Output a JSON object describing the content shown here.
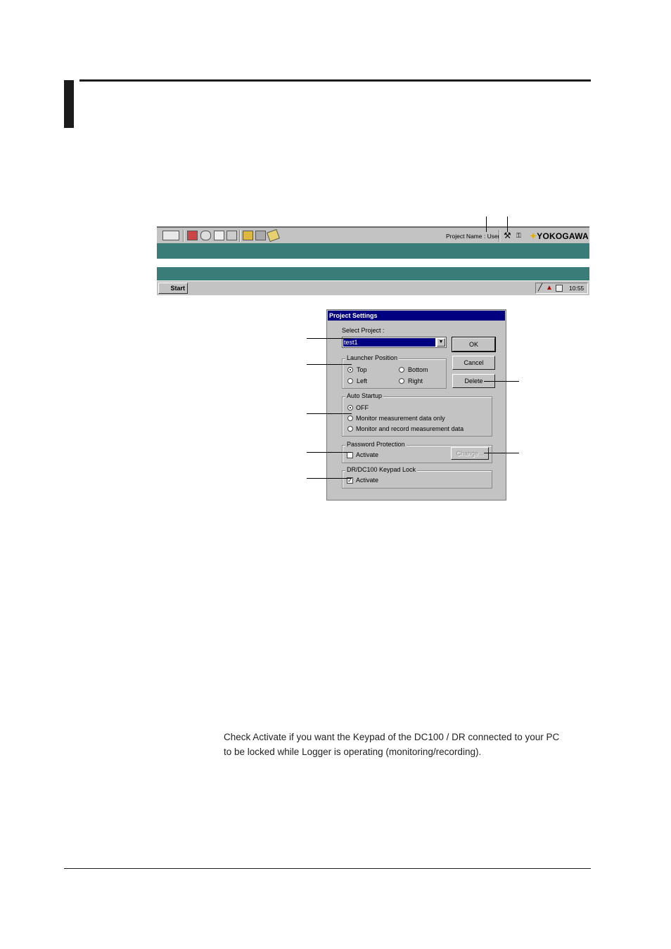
{
  "launcher": {
    "project_label": "Project Name : User",
    "logo_text": "YOKOGAWA",
    "logo_star": "✦",
    "toolbar_icons": [
      "monitor-icon",
      "recorder-icon",
      "viewer-icon",
      "search-icon",
      "network-icon",
      "printer-icon",
      "calculator-icon",
      "report-icon",
      "tag-icon"
    ],
    "start_label": "Start",
    "clock": "10:55"
  },
  "dialog": {
    "title": "Project Settings",
    "select_project_label": "Select Project :",
    "select_project_value": "test1",
    "ok_label": "OK",
    "cancel_label": "Cancel",
    "delete_label": "Delete",
    "launcher_position": {
      "caption": "Launcher Position",
      "top": "Top",
      "bottom": "Bottom",
      "left": "Left",
      "right": "Right",
      "selected": "Top"
    },
    "auto_startup": {
      "caption": "Auto Startup",
      "off": "OFF",
      "monitor_only": "Monitor measurement data only",
      "monitor_record": "Monitor and record measurement data",
      "selected": "OFF"
    },
    "password_protection": {
      "caption": "Password Protection",
      "activate_label": "Activate",
      "activated": false,
      "change_label": "Change..."
    },
    "keypad_lock": {
      "caption": "DR/DC100 Keypad Lock",
      "activate_label": "Activate",
      "activated": true
    }
  },
  "body_text": {
    "keypad_line1": "Check Activate if you want the Keypad of the DC100 / DR connected to your PC",
    "keypad_line2": "to be locked while Logger is operating (monitoring/recording)."
  }
}
